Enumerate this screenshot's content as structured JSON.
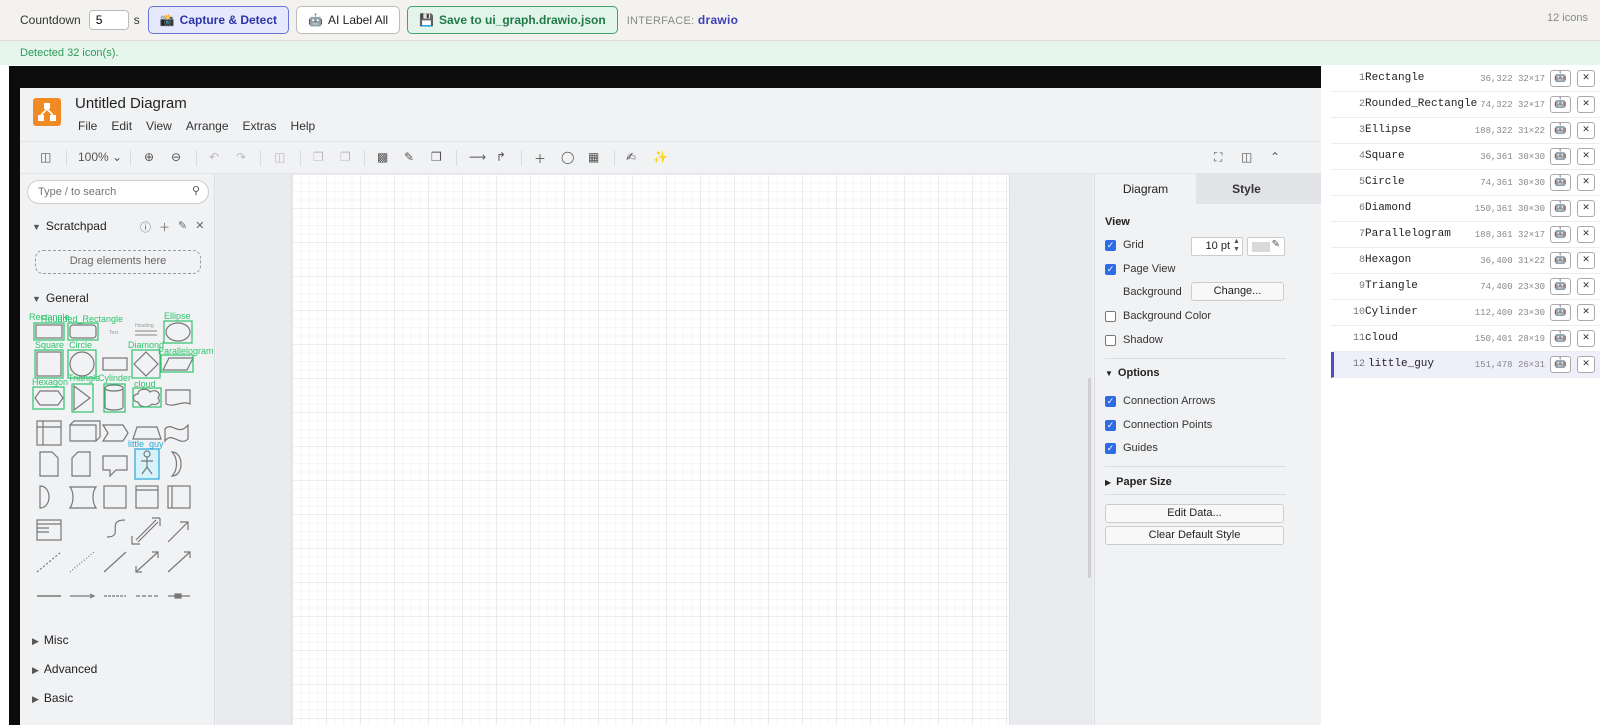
{
  "topbar": {
    "countdown_label": "Countdown",
    "countdown_value": "5",
    "countdown_unit": "s",
    "capture_label": "Capture & Detect",
    "ai_label": "AI Label All",
    "save_label": "Save to ui_graph.drawio.json",
    "interface_label": "INTERFACE:",
    "interface_value": "drawio",
    "icon_count": "12 icons"
  },
  "status": {
    "detected": "Detected 32 icon(s)."
  },
  "drawio": {
    "title": "Untitled Diagram",
    "menu": [
      "File",
      "Edit",
      "View",
      "Arrange",
      "Extras",
      "Help"
    ],
    "zoom": "100%",
    "search_placeholder": "Type / to search",
    "scratchpad": "Scratchpad",
    "drag_hint": "Drag elements here",
    "general": "General",
    "collapsed_sections": [
      "Misc",
      "Advanced",
      "Basic"
    ],
    "shape_labels": {
      "rectangle": "Rectangle",
      "rounded": "Rounded_Rectangle",
      "ellipse": "Ellipse",
      "square": "Square",
      "circle": "Circle",
      "diamond": "Diamond",
      "parallelogram": "Parallelogram",
      "hexagon": "Hexagon",
      "triangle": "Triangle",
      "cylinder": "Cylinder",
      "cloud": "cloud",
      "little_guy": "little_guy",
      "text": "Text",
      "heading": "Heading"
    },
    "format": {
      "tab_diagram": "Diagram",
      "tab_style": "Style",
      "view": "View",
      "grid": "Grid",
      "grid_size": "10 pt",
      "page_view": "Page View",
      "background": "Background",
      "change": "Change...",
      "background_color": "Background Color",
      "shadow": "Shadow",
      "options": "Options",
      "connection_arrows": "Connection Arrows",
      "connection_points": "Connection Points",
      "guides": "Guides",
      "paper_size": "Paper Size",
      "edit_data": "Edit Data...",
      "clear_style": "Clear Default Style"
    }
  },
  "icons": [
    {
      "n": "1",
      "name": "Rectangle",
      "geo": "36,322 32×17"
    },
    {
      "n": "2",
      "name": "Rounded_Rectangle",
      "geo": "74,322 32×17"
    },
    {
      "n": "3",
      "name": "Ellipse",
      "geo": "188,322 31×22"
    },
    {
      "n": "4",
      "name": "Square",
      "geo": "36,361 30×30"
    },
    {
      "n": "5",
      "name": "Circle",
      "geo": "74,361 30×30"
    },
    {
      "n": "6",
      "name": "Diamond",
      "geo": "150,361 30×30"
    },
    {
      "n": "7",
      "name": "Parallelogram",
      "geo": "188,361 32×17"
    },
    {
      "n": "8",
      "name": "Hexagon",
      "geo": "36,400 31×22"
    },
    {
      "n": "9",
      "name": "Triangle",
      "geo": "74,400 23×30"
    },
    {
      "n": "10",
      "name": "Cylinder",
      "geo": "112,400 23×30"
    },
    {
      "n": "11",
      "name": "cloud",
      "geo": "150,401 28×19"
    },
    {
      "n": "12",
      "name": "little_guy",
      "geo": "151,478 26×31"
    }
  ]
}
